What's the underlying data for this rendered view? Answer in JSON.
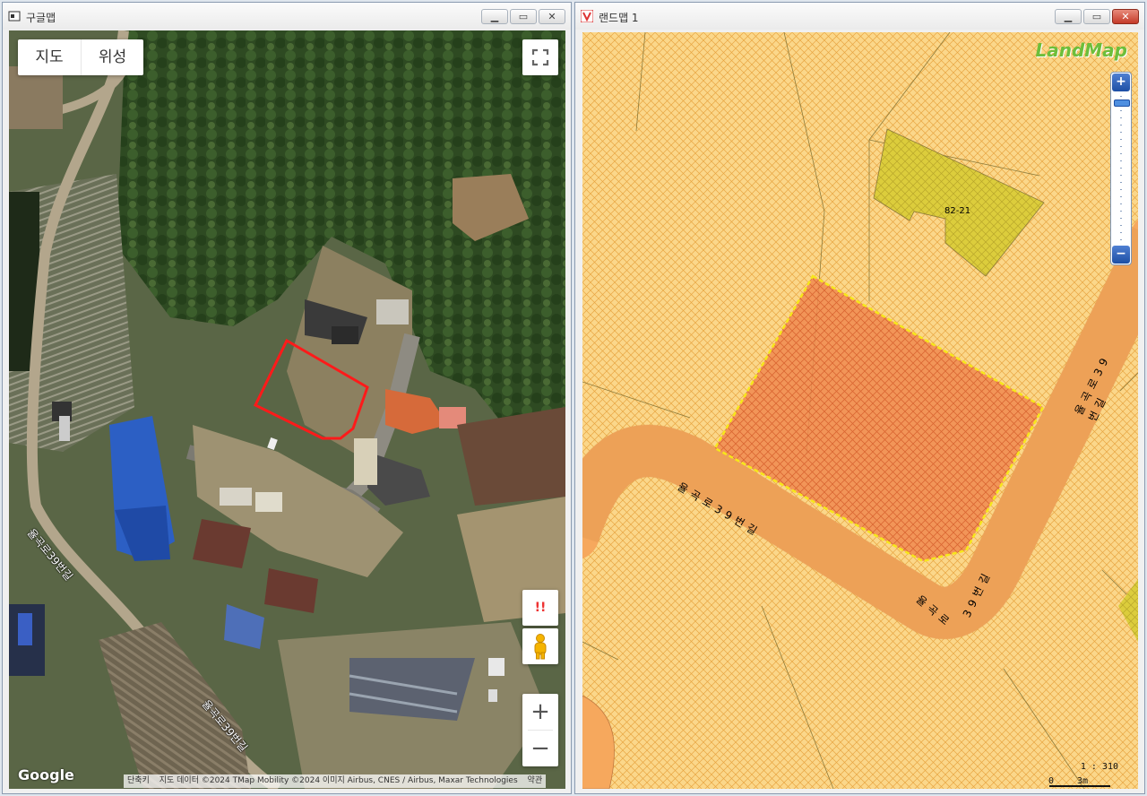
{
  "left_window": {
    "title": "구글맵",
    "maptype": {
      "map_label": "지도",
      "satellite_label": "위성"
    },
    "road_labels": [
      "율곡로39번길",
      "율곡로39번길"
    ],
    "report_glyph": "!!",
    "zoom_in": "+",
    "zoom_out": "−",
    "google_logo": "Google",
    "attribution": {
      "shortcuts": "단축키",
      "map_data": "지도 데이터 ©2024 TMap Mobility ©2024 이미지 Airbus, CNES / Airbus, Maxar Technologies",
      "terms": "약관"
    }
  },
  "right_window": {
    "title": "랜드맵 1",
    "logo": "LandMap",
    "parcel_label": "82-21",
    "road_labels": [
      "율곡로39번길",
      "율곡로",
      "39번길"
    ],
    "scale_ratio": "1 : 310",
    "scale_min": "0",
    "scale_max": "3m",
    "zoom_in": "+",
    "zoom_out": "−",
    "colors": {
      "zoning": "#fbd78a",
      "road": "#f6a85d",
      "parcel": "#f08a4f",
      "building": "#dccd3c",
      "boundary": "#f7e71a"
    }
  }
}
